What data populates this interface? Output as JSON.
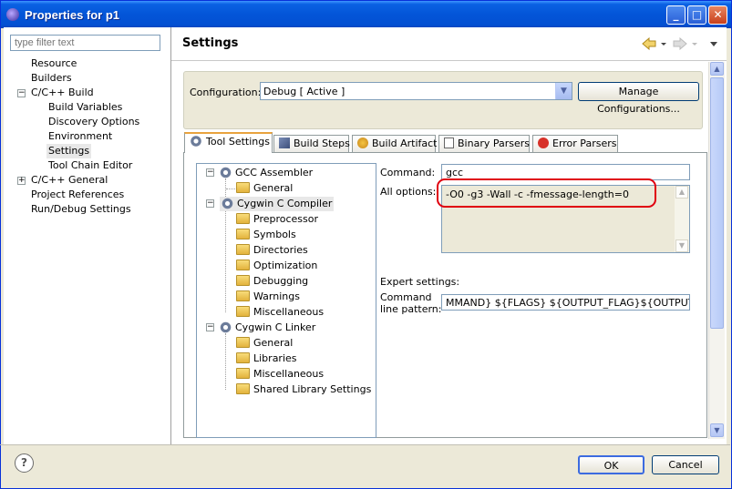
{
  "window": {
    "title": "Properties for p1"
  },
  "filter": {
    "placeholder": "type filter text"
  },
  "nav": {
    "items": [
      {
        "label": "Resource"
      },
      {
        "label": "Builders"
      },
      {
        "label": "C/C++ Build"
      },
      {
        "label": "Build Variables"
      },
      {
        "label": "Discovery Options"
      },
      {
        "label": "Environment"
      },
      {
        "label": "Settings"
      },
      {
        "label": "Tool Chain Editor"
      },
      {
        "label": "C/C++ General"
      },
      {
        "label": "Project References"
      },
      {
        "label": "Run/Debug Settings"
      }
    ]
  },
  "page": {
    "title": "Settings"
  },
  "config": {
    "label": "Configuration:",
    "value": "Debug  [ Active ]",
    "manage_button": "Manage Configurations..."
  },
  "tabs": [
    {
      "label": "Tool Settings"
    },
    {
      "label": "Build Steps"
    },
    {
      "label": "Build Artifact"
    },
    {
      "label": "Binary Parsers"
    },
    {
      "label": "Error Parsers"
    }
  ],
  "tool_tree": {
    "items": [
      {
        "label": "GCC Assembler"
      },
      {
        "label": "General"
      },
      {
        "label": "Cygwin C Compiler"
      },
      {
        "label": "Preprocessor"
      },
      {
        "label": "Symbols"
      },
      {
        "label": "Directories"
      },
      {
        "label": "Optimization"
      },
      {
        "label": "Debugging"
      },
      {
        "label": "Warnings"
      },
      {
        "label": "Miscellaneous"
      },
      {
        "label": "Cygwin C Linker"
      },
      {
        "label": "General"
      },
      {
        "label": "Libraries"
      },
      {
        "label": "Miscellaneous"
      },
      {
        "label": "Shared Library Settings"
      }
    ]
  },
  "settings": {
    "command_label": "Command:",
    "command_value": "gcc",
    "all_options_label": "All options:",
    "all_options_value": "-O0 -g3 -Wall -c -fmessage-length=0",
    "expert_label": "Expert settings:",
    "command_line_label_1": "Command",
    "command_line_label_2": "line pattern:",
    "command_line_value": "MMAND} ${FLAGS} ${OUTPUT_FLAG}${OUTPUT_PREF"
  },
  "buttons": {
    "ok": "OK",
    "cancel": "Cancel"
  },
  "colors": {
    "titlebar": "#0355d8",
    "highlight": "#e0000f",
    "active_tab": "#e8a33e"
  }
}
